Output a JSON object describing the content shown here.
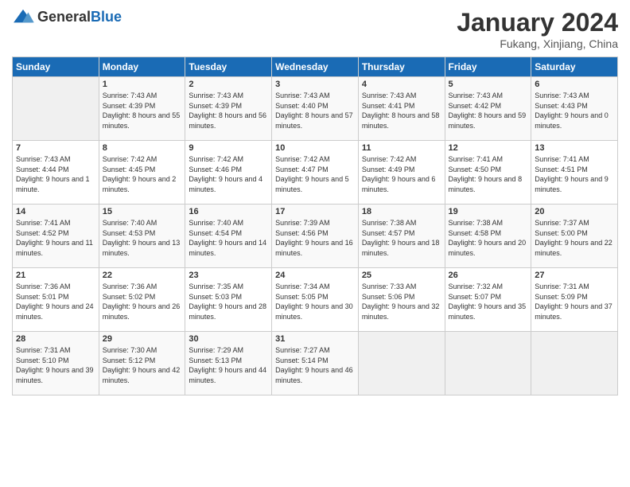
{
  "header": {
    "logo_general": "General",
    "logo_blue": "Blue",
    "title": "January 2024",
    "subtitle": "Fukang, Xinjiang, China"
  },
  "weekdays": [
    "Sunday",
    "Monday",
    "Tuesday",
    "Wednesday",
    "Thursday",
    "Friday",
    "Saturday"
  ],
  "weeks": [
    [
      {
        "day": "",
        "empty": true
      },
      {
        "day": "1",
        "sunrise": "7:43 AM",
        "sunset": "4:39 PM",
        "daylight": "8 hours and 55 minutes."
      },
      {
        "day": "2",
        "sunrise": "7:43 AM",
        "sunset": "4:39 PM",
        "daylight": "8 hours and 56 minutes."
      },
      {
        "day": "3",
        "sunrise": "7:43 AM",
        "sunset": "4:40 PM",
        "daylight": "8 hours and 57 minutes."
      },
      {
        "day": "4",
        "sunrise": "7:43 AM",
        "sunset": "4:41 PM",
        "daylight": "8 hours and 58 minutes."
      },
      {
        "day": "5",
        "sunrise": "7:43 AM",
        "sunset": "4:42 PM",
        "daylight": "8 hours and 59 minutes."
      },
      {
        "day": "6",
        "sunrise": "7:43 AM",
        "sunset": "4:43 PM",
        "daylight": "9 hours and 0 minutes."
      }
    ],
    [
      {
        "day": "7",
        "sunrise": "7:43 AM",
        "sunset": "4:44 PM",
        "daylight": "9 hours and 1 minute."
      },
      {
        "day": "8",
        "sunrise": "7:42 AM",
        "sunset": "4:45 PM",
        "daylight": "9 hours and 2 minutes."
      },
      {
        "day": "9",
        "sunrise": "7:42 AM",
        "sunset": "4:46 PM",
        "daylight": "9 hours and 4 minutes."
      },
      {
        "day": "10",
        "sunrise": "7:42 AM",
        "sunset": "4:47 PM",
        "daylight": "9 hours and 5 minutes."
      },
      {
        "day": "11",
        "sunrise": "7:42 AM",
        "sunset": "4:49 PM",
        "daylight": "9 hours and 6 minutes."
      },
      {
        "day": "12",
        "sunrise": "7:41 AM",
        "sunset": "4:50 PM",
        "daylight": "9 hours and 8 minutes."
      },
      {
        "day": "13",
        "sunrise": "7:41 AM",
        "sunset": "4:51 PM",
        "daylight": "9 hours and 9 minutes."
      }
    ],
    [
      {
        "day": "14",
        "sunrise": "7:41 AM",
        "sunset": "4:52 PM",
        "daylight": "9 hours and 11 minutes."
      },
      {
        "day": "15",
        "sunrise": "7:40 AM",
        "sunset": "4:53 PM",
        "daylight": "9 hours and 13 minutes."
      },
      {
        "day": "16",
        "sunrise": "7:40 AM",
        "sunset": "4:54 PM",
        "daylight": "9 hours and 14 minutes."
      },
      {
        "day": "17",
        "sunrise": "7:39 AM",
        "sunset": "4:56 PM",
        "daylight": "9 hours and 16 minutes."
      },
      {
        "day": "18",
        "sunrise": "7:38 AM",
        "sunset": "4:57 PM",
        "daylight": "9 hours and 18 minutes."
      },
      {
        "day": "19",
        "sunrise": "7:38 AM",
        "sunset": "4:58 PM",
        "daylight": "9 hours and 20 minutes."
      },
      {
        "day": "20",
        "sunrise": "7:37 AM",
        "sunset": "5:00 PM",
        "daylight": "9 hours and 22 minutes."
      }
    ],
    [
      {
        "day": "21",
        "sunrise": "7:36 AM",
        "sunset": "5:01 PM",
        "daylight": "9 hours and 24 minutes."
      },
      {
        "day": "22",
        "sunrise": "7:36 AM",
        "sunset": "5:02 PM",
        "daylight": "9 hours and 26 minutes."
      },
      {
        "day": "23",
        "sunrise": "7:35 AM",
        "sunset": "5:03 PM",
        "daylight": "9 hours and 28 minutes."
      },
      {
        "day": "24",
        "sunrise": "7:34 AM",
        "sunset": "5:05 PM",
        "daylight": "9 hours and 30 minutes."
      },
      {
        "day": "25",
        "sunrise": "7:33 AM",
        "sunset": "5:06 PM",
        "daylight": "9 hours and 32 minutes."
      },
      {
        "day": "26",
        "sunrise": "7:32 AM",
        "sunset": "5:07 PM",
        "daylight": "9 hours and 35 minutes."
      },
      {
        "day": "27",
        "sunrise": "7:31 AM",
        "sunset": "5:09 PM",
        "daylight": "9 hours and 37 minutes."
      }
    ],
    [
      {
        "day": "28",
        "sunrise": "7:31 AM",
        "sunset": "5:10 PM",
        "daylight": "9 hours and 39 minutes."
      },
      {
        "day": "29",
        "sunrise": "7:30 AM",
        "sunset": "5:12 PM",
        "daylight": "9 hours and 42 minutes."
      },
      {
        "day": "30",
        "sunrise": "7:29 AM",
        "sunset": "5:13 PM",
        "daylight": "9 hours and 44 minutes."
      },
      {
        "day": "31",
        "sunrise": "7:27 AM",
        "sunset": "5:14 PM",
        "daylight": "9 hours and 46 minutes."
      },
      {
        "day": "",
        "empty": true
      },
      {
        "day": "",
        "empty": true
      },
      {
        "day": "",
        "empty": true
      }
    ]
  ]
}
